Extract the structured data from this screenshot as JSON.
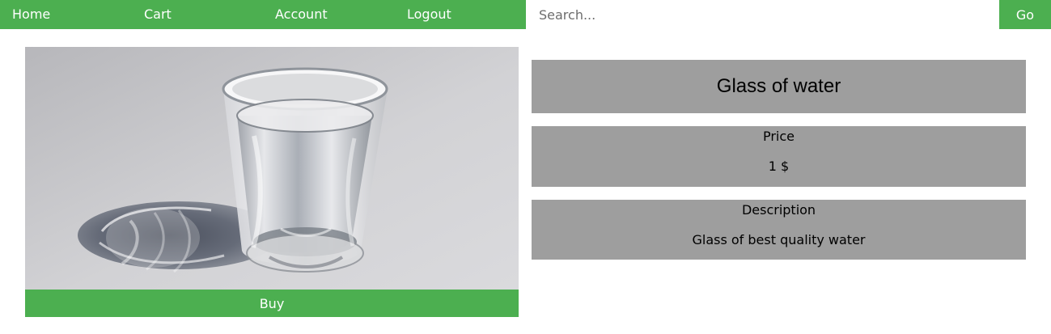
{
  "navigation": {
    "items": [
      {
        "label": "Home"
      },
      {
        "label": "Cart"
      },
      {
        "label": "Account"
      },
      {
        "label": "Logout"
      }
    ]
  },
  "search": {
    "placeholder": "Search...",
    "value": "",
    "button_label": "Go"
  },
  "product": {
    "title": "Glass of water",
    "price_label": "Price",
    "price_value": "1 $",
    "description_label": "Description",
    "description_value": "Glass of best quality water",
    "buy_label": "Buy",
    "image_subject": "glass of water photo"
  },
  "colors": {
    "accent": "#4caf50",
    "panel_background": "#9e9e9e",
    "button_text": "#ffffff",
    "panel_text": "#000000"
  }
}
